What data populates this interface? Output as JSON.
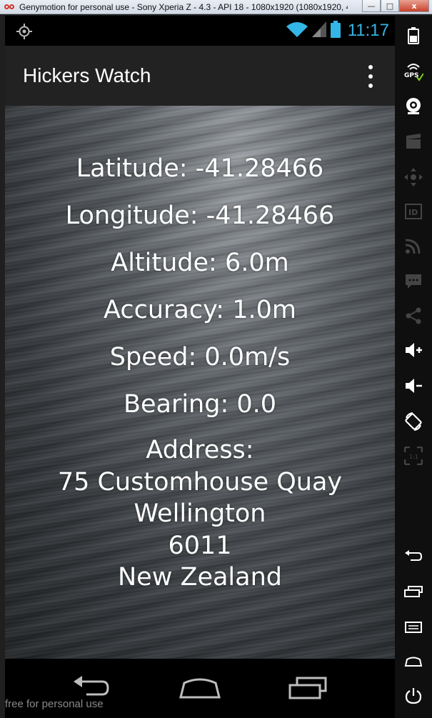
{
  "window": {
    "title": "Genymotion for personal use - Sony Xperia Z - 4.3 - API 18 - 1080x1920 (1080x1920, 4...",
    "minimize_glyph": "—",
    "maximize_glyph": "□",
    "close_glyph": "x"
  },
  "status_bar": {
    "time": "11:17",
    "icons": [
      "gps-icon",
      "wifi-icon",
      "signal-icon",
      "battery-icon"
    ],
    "accent": "#33b5e5"
  },
  "action_bar": {
    "title": "Hickers Watch",
    "menu_icon": "overflow-menu-icon"
  },
  "location": {
    "latitude": "Latitude: -41.28466",
    "longitude": "Longitude: -41.28466",
    "altitude": "Altitude: 6.0m",
    "accuracy": "Accuracy: 1.0m",
    "speed": "Speed: 0.0m/s",
    "bearing": "Bearing: 0.0",
    "address_label": "Address:",
    "address_lines": [
      "75 Customhouse Quay",
      "Wellington",
      "6011",
      "New Zealand"
    ]
  },
  "nav_bar": {
    "buttons": [
      "back-icon",
      "home-icon",
      "recent-apps-icon"
    ]
  },
  "watermark": "free for personal use",
  "toolbar": {
    "tools": [
      "battery-tool-icon",
      "gps-tool-icon",
      "camera-tool-icon",
      "video-capture-icon",
      "dpad-icon",
      "device-id-icon",
      "rss-icon",
      "sms-icon",
      "share-icon",
      "volume-up-icon",
      "volume-down-icon",
      "rotate-icon",
      "scale-icon",
      "back-tool-icon",
      "recent-tool-icon",
      "menu-tool-icon",
      "home-tool-icon",
      "power-icon"
    ]
  }
}
